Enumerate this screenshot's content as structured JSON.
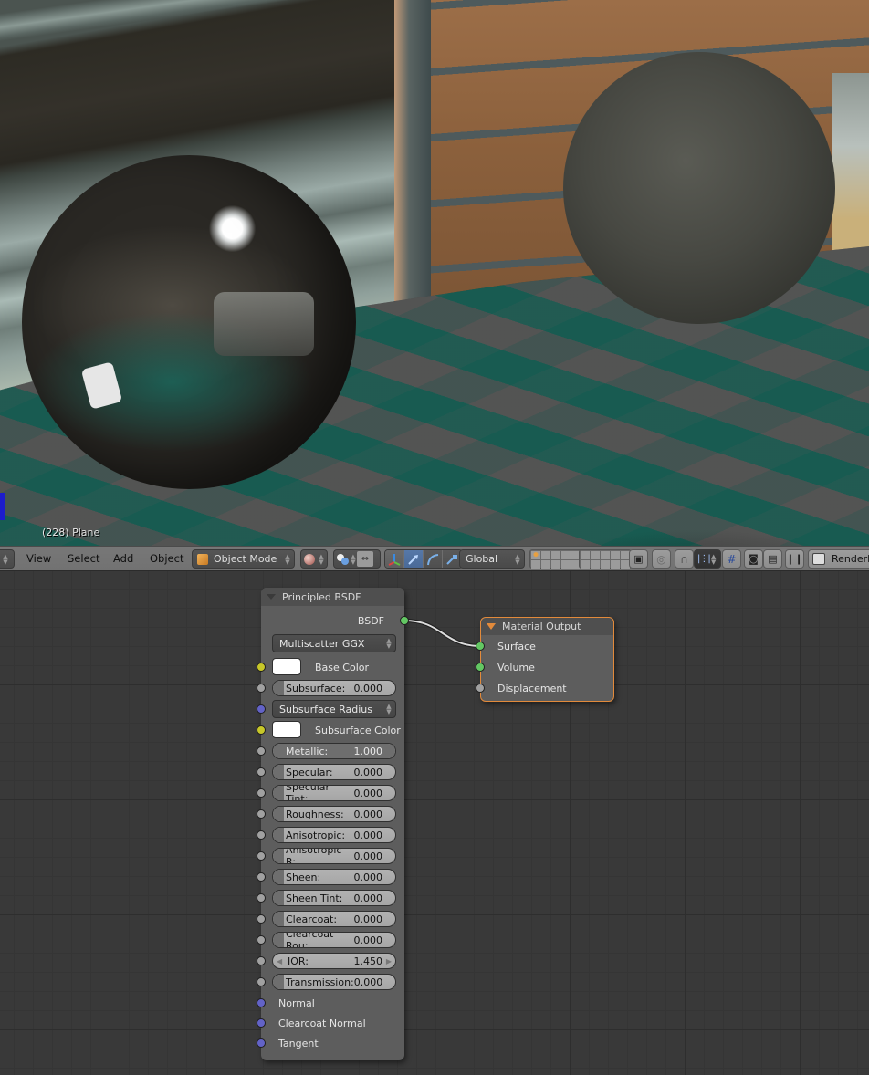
{
  "viewport": {
    "object_label": "(228) Plane"
  },
  "header": {
    "menus": [
      "View",
      "Select",
      "Add",
      "Object"
    ],
    "mode": "Object Mode",
    "transform_orientation": "Global",
    "render_layer_label": "RenderL",
    "icons": {
      "editor_type": "editor-type-icon",
      "mode": "cube-icon",
      "shading": "sphere-shading-icon",
      "pivot": "pivot-icon",
      "manipulator": "manipulator-axes-icon",
      "translate": "translate-arrow-icon",
      "rotate": "rotate-arc-icon",
      "scale": "scale-icon",
      "layers_lock": "layer-lock-icon",
      "proportional": "proportional-edit-icon",
      "snap": "magnet-icon",
      "snap_element": "snap-element-icon",
      "snap_target": "snap-target-icon",
      "render_still": "camera-render-icon",
      "render_anim": "clapper-icon",
      "pause": "pause-icon",
      "render_layers": "render-layers-icon"
    }
  },
  "nodes": {
    "principled": {
      "title": "Principled BSDF",
      "output_label": "BSDF",
      "distribution": "Multiscatter GGX",
      "subsurface_method": "Subsurface Radius",
      "base_color_label": "Base Color",
      "base_color": "#ffffff",
      "subsurface_color_label": "Subsurface Color",
      "subsurface_color": "#ffffff",
      "subsurface": {
        "label": "Subsurface:",
        "value": "0.000",
        "fraction": 0.0
      },
      "params": [
        {
          "label": "Metallic:",
          "value": "1.000",
          "fraction": 1.0
        },
        {
          "label": "Specular:",
          "value": "0.000",
          "fraction": 0.0
        },
        {
          "label": "Specular Tint:",
          "value": "0.000",
          "fraction": 0.0
        },
        {
          "label": "Roughness:",
          "value": "0.000",
          "fraction": 0.0
        },
        {
          "label": "Anisotropic:",
          "value": "0.000",
          "fraction": 0.0
        },
        {
          "label": "Anisotropic R:",
          "value": "0.000",
          "fraction": 0.0
        },
        {
          "label": "Sheen:",
          "value": "0.000",
          "fraction": 0.0
        },
        {
          "label": "Sheen Tint:",
          "value": "0.000",
          "fraction": 0.0
        },
        {
          "label": "Clearcoat:",
          "value": "0.000",
          "fraction": 0.0
        },
        {
          "label": "Clearcoat Rou:",
          "value": "0.000",
          "fraction": 0.0
        }
      ],
      "ior": {
        "label": "IOR:",
        "value": "1.450"
      },
      "transmission": {
        "label": "Transmission:",
        "value": "0.000",
        "fraction": 0.0
      },
      "vector_inputs": [
        "Normal",
        "Clearcoat Normal",
        "Tangent"
      ]
    },
    "material_output": {
      "title": "Material Output",
      "inputs": [
        "Surface",
        "Volume",
        "Displacement"
      ],
      "accent": "#e28a3b"
    }
  }
}
